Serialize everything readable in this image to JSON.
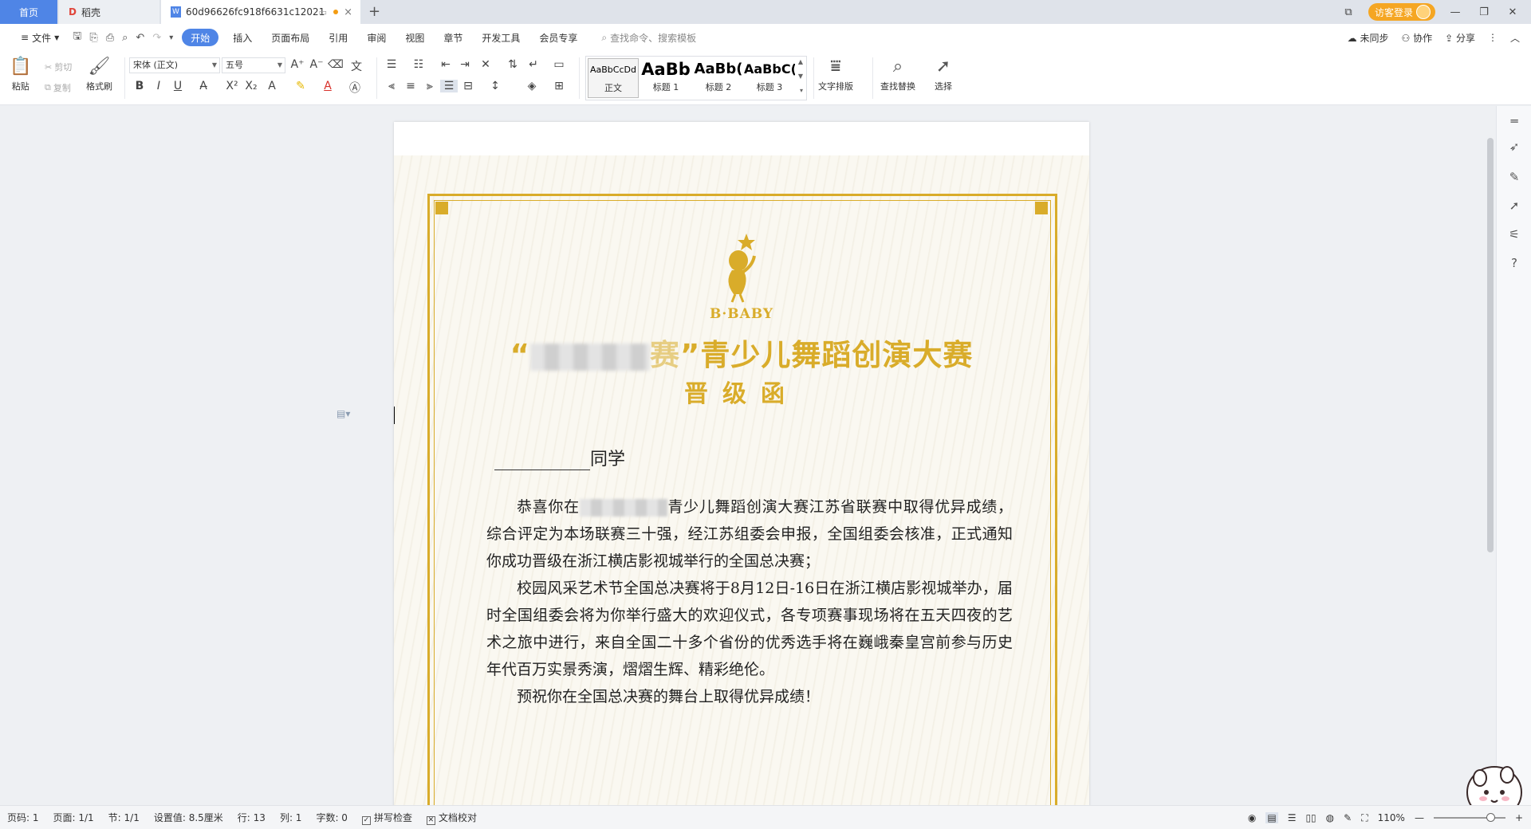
{
  "tabs": {
    "home": "首页",
    "daoke": "稻壳",
    "doc": "60d96626fc918f6631c12021",
    "new_tab": "+"
  },
  "titlebar": {
    "login": "访客登录"
  },
  "menu": {
    "file": "文件",
    "items": [
      "开始",
      "插入",
      "页面布局",
      "引用",
      "审阅",
      "视图",
      "章节",
      "开发工具",
      "会员专享"
    ],
    "search": "查找命令、搜索模板",
    "right": [
      "未同步",
      "协作",
      "分享"
    ]
  },
  "ribbon": {
    "paste": "粘贴",
    "cut": "剪切",
    "copy": "复制",
    "format_painter": "格式刷",
    "font_name": "宋体 (正文)",
    "font_size": "五号",
    "styles": [
      {
        "preview": "AaBbCcDd",
        "name": "正文"
      },
      {
        "preview": "AaBb",
        "name": "标题 1"
      },
      {
        "preview": "AaBb(",
        "name": "标题 2"
      },
      {
        "preview": "AaBbC(",
        "name": "标题 3"
      }
    ],
    "text_layout": "文字排版",
    "find_replace": "查找替换",
    "select": "选择"
  },
  "document": {
    "logo_text": "B·BABY",
    "title_prefix": "“",
    "title_blur_tail": "”青少儿舞蹈创演大赛",
    "title_hidden_char": "赛",
    "subtitle": "晋级函",
    "greeting": "同学",
    "p1_start": "恭喜你在",
    "p1_rest": "青少儿舞蹈创演大赛江苏省联赛中取得优异成绩，综合评定为本场联赛三十强，经江苏组委会申报，全国组委会核准，正式通知你成功晋级在浙江横店影视城举行的全国总决赛；",
    "p2": "校园风采艺术节全国总决赛将于8月12日-16日在浙江横店影视城举办，届时全国组委会将为你举行盛大的欢迎仪式，各专项赛事现场将在五天四夜的艺术之旅中进行，来自全国二十多个省份的优秀选手将在巍峨秦皇宫前参与历史年代百万实景秀演，熠熠生辉、精彩绝伦。",
    "p3": "预祝你在全国总决赛的舞台上取得优异成绩！"
  },
  "status": {
    "page": "页码: 1",
    "pages": "页面: 1/1",
    "section": "节: 1/1",
    "setting": "设置值: 8.5厘米",
    "row": "行: 13",
    "col": "列: 1",
    "words": "字数: 0",
    "spell": "拼写检查",
    "proof": "文档校对",
    "zoom": "110%"
  },
  "colors": {
    "accent": "#4f85e6",
    "gold": "#d9ac2a",
    "login": "#f5a623"
  }
}
